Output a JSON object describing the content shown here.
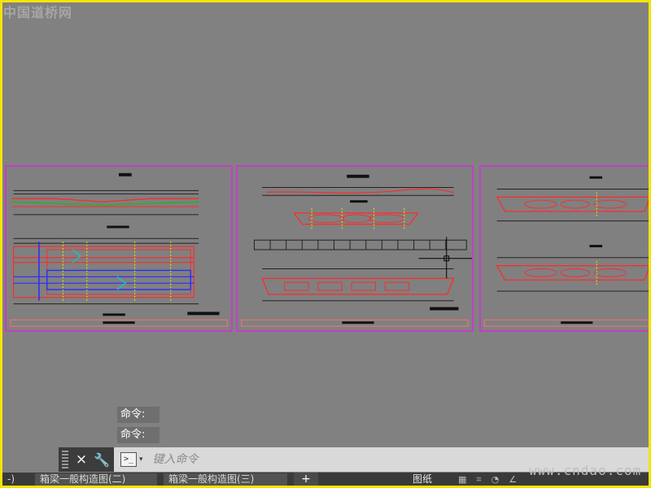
{
  "watermark_top": "中国道桥网",
  "watermark_bottom": "www.cndao.com",
  "command_history": [
    "命令:",
    "命令:"
  ],
  "command_line": {
    "placeholder": "键入命令",
    "close_icon": "×",
    "wrench_icon": "🔧",
    "prompt_icon": ">_",
    "dropdown_icon": "▾"
  },
  "layout_tabs": {
    "partial_tab": "-)",
    "tab1": "箱梁一般构造图(二)",
    "tab2": "箱梁一般构造图(三)",
    "plus": "+"
  },
  "status_bar": {
    "label": "图纸",
    "icons": [
      "grid-icon",
      "snap-icon",
      "orbit-icon",
      "angle-icon"
    ]
  },
  "colors": {
    "background": "#818181",
    "sheet_border": "#c23fc7",
    "frame_border": "#f5e400",
    "red_lines": "#ff2a2a",
    "blue_lines": "#2a2aff",
    "green_lines": "#3aa63a"
  }
}
